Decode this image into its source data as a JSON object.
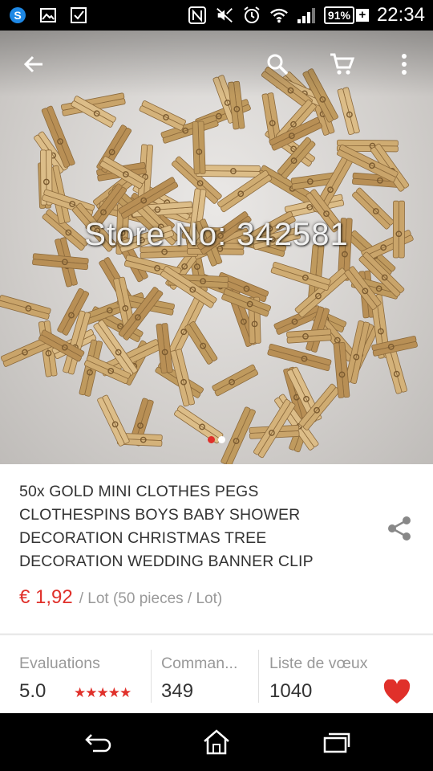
{
  "status_bar": {
    "battery": "91%",
    "time": "22:34",
    "icons": [
      "skype-icon",
      "image-icon",
      "checkbox-icon",
      "nfc-icon",
      "mute-icon",
      "alarm-icon",
      "wifi-icon",
      "signal-icon",
      "battery-icon"
    ]
  },
  "top_bar": {
    "icons": [
      "back-arrow-icon",
      "search-icon",
      "cart-icon",
      "more-vert-icon"
    ]
  },
  "image": {
    "watermark": "Store No: 342581",
    "page_count": 2,
    "active_page": 1
  },
  "product": {
    "title": "50x GOLD MINI CLOTHES PEGS CLOTHESPINS BOYS BABY SHOWER DECORATION CHRISTMAS TREE DECORATION WEDDING BANNER CLIP",
    "price": "€ 1,92",
    "unit": "/ Lot (50 pieces / Lot)"
  },
  "stats": {
    "evaluations_label": "Evaluations",
    "evaluations_value": "5.0",
    "stars": "★★★★★",
    "rating_fraction": 1.0,
    "orders_label": "Comman...",
    "orders_value": "349",
    "wishlist_label": "Liste de vœux",
    "wishlist_value": "1040"
  },
  "colors": {
    "accent": "#e0302a",
    "text": "#333333",
    "muted": "#999999"
  },
  "nav_bar": {
    "icons": [
      "back-nav-icon",
      "home-nav-icon",
      "recents-nav-icon"
    ]
  }
}
